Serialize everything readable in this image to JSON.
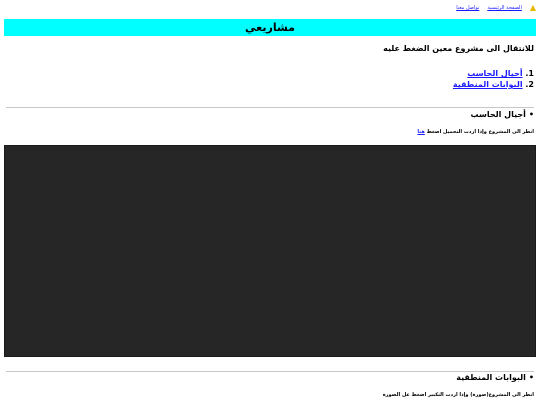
{
  "topnav": {
    "home_label": "الصفحة الرئيسية",
    "contact_label": "تواصل معنا"
  },
  "banner": {
    "title": "مشاريعي"
  },
  "intro": {
    "text": "للانتقال الى مشروع معين الضغط عليه"
  },
  "projects": [
    {
      "number": "1.",
      "label": "أجيال الحاسب"
    },
    {
      "number": "2.",
      "label": "البوابات المنطقية"
    }
  ],
  "section1": {
    "bullet": "•",
    "title": "أجيال الحاسب",
    "desc_prefix": "انظر الى المشروع وإذا اردت التحميل اضغط",
    "desc_link": "هنا"
  },
  "section2": {
    "bullet": "•",
    "title": "البوابات المنطقية",
    "desc": "انظر الى المشروع(صورة) وإذا اردت التكبير اضغط عل الصورة"
  },
  "colors": {
    "banner_bg": "#00ffff",
    "link": "#1a1aff",
    "preview_bg": "#262626"
  },
  "icons": {
    "home": "home-icon"
  }
}
